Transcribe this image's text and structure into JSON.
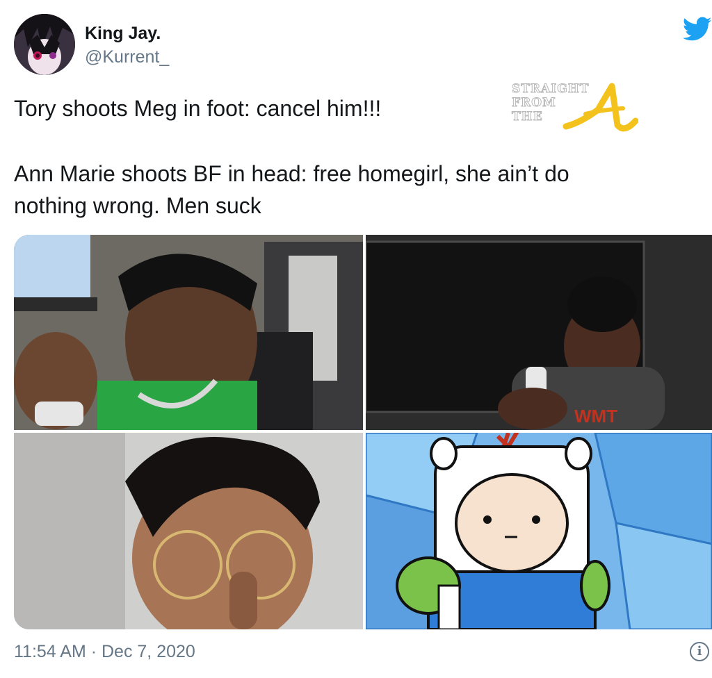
{
  "author": {
    "display_name": "King Jay.",
    "handle": "@Kurrent_"
  },
  "tweet": {
    "lines": [
      "Tory shoots Meg in foot: cancel him!!!",
      "",
      "Ann Marie shoots BF in head: free homegirl, she ain’t do",
      "nothing wrong. Men suck"
    ]
  },
  "watermark": {
    "lines": [
      "STRAIGHT",
      "FROM",
      "THE"
    ],
    "letter": "A"
  },
  "meta": {
    "timestamp": "11:54 AM · Dec 7, 2020"
  },
  "icons": {
    "brand": "twitter-bird-icon",
    "info": "info-icon"
  },
  "colors": {
    "brand_blue": "#1da1f2",
    "text": "#14171a",
    "muted": "#657786",
    "finn_blue": "#2f7dd6",
    "finn_green": "#7bc24a"
  }
}
